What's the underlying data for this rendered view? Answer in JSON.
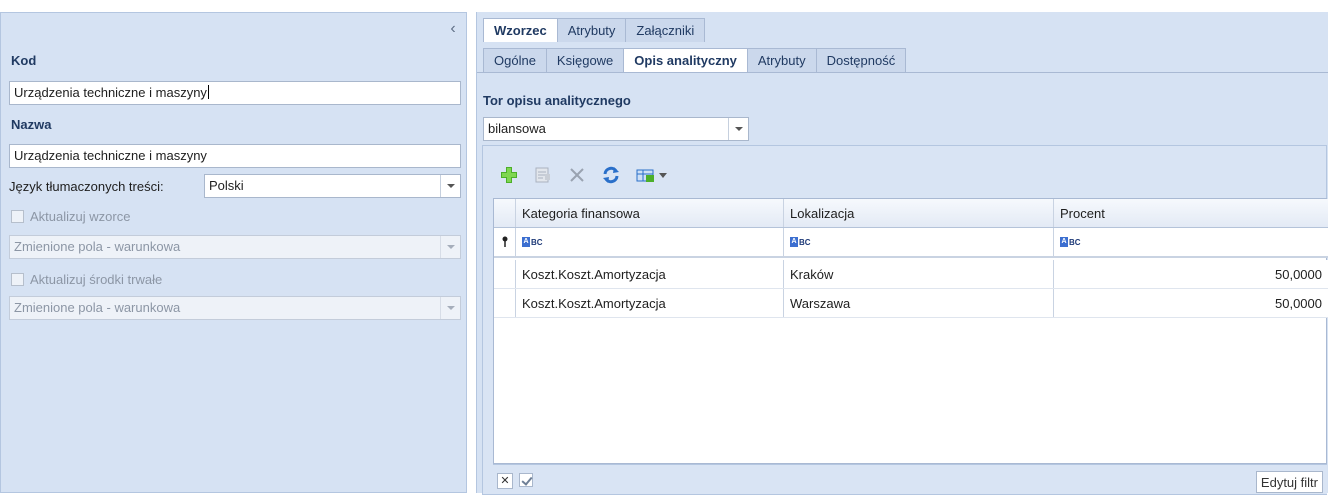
{
  "left": {
    "kod_label": "Kod",
    "kod_value": "Urządzenia techniczne i maszyny",
    "nazwa_label": "Nazwa",
    "nazwa_value": "Urządzenia techniczne i maszyny",
    "lang_label": "Język tłumaczonych treści:",
    "lang_value": "Polski",
    "update_templates_label": "Aktualizuj wzorce",
    "update_templates_mode": "Zmienione pola - warunkowa",
    "update_assets_label": "Aktualizuj środki trwałe",
    "update_assets_mode": "Zmienione pola - warunkowa",
    "collapse_glyph": "‹"
  },
  "top_tabs": [
    {
      "label": "Wzorzec",
      "active": true
    },
    {
      "label": "Atrybuty",
      "active": false
    },
    {
      "label": "Załączniki",
      "active": false
    }
  ],
  "inner_tabs": [
    {
      "label": "Ogólne",
      "active": false
    },
    {
      "label": "Księgowe",
      "active": false
    },
    {
      "label": "Opis analityczny",
      "active": true
    },
    {
      "label": "Atrybuty",
      "active": false
    },
    {
      "label": "Dostępność",
      "active": false
    }
  ],
  "tor": {
    "label": "Tor opisu analitycznego",
    "value": "bilansowa"
  },
  "grid": {
    "columns": [
      "Kategoria finansowa",
      "Lokalizacja",
      "Procent"
    ],
    "filter_glyph": "BC",
    "rows": [
      {
        "kategoria": "Koszt.Koszt.Amortyzacja",
        "lokalizacja": "Kraków",
        "procent": "50,0000"
      },
      {
        "kategoria": "Koszt.Koszt.Amortyzacja",
        "lokalizacja": "Warszawa",
        "procent": "50,0000"
      }
    ]
  },
  "footer": {
    "clear_glyph": "✕",
    "edit_filter_label": "Edytuj filtr"
  },
  "colors": {
    "panel_bg": "#d6e2f3",
    "accent_text": "#203a62",
    "add_icon": "#4caf2a",
    "refresh_icon": "#2a6fc9"
  }
}
